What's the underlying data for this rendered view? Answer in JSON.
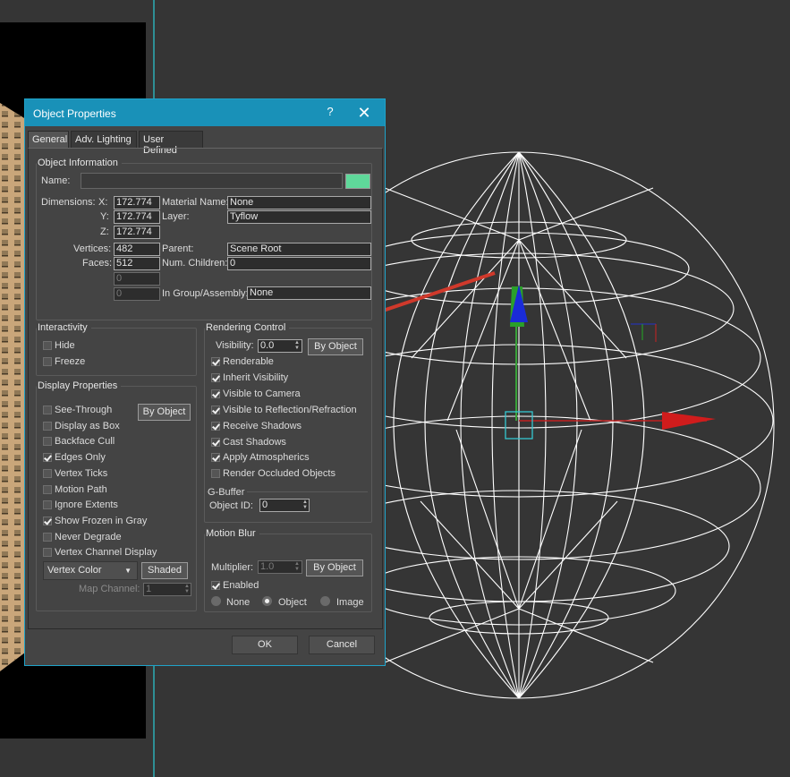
{
  "dialog": {
    "title": "Object Properties",
    "help": "?",
    "close": "✕",
    "tabs": [
      "General",
      "Adv. Lighting",
      "User Defined"
    ]
  },
  "object_info": {
    "title": "Object Information",
    "name_label": "Name:",
    "name_value": "",
    "color": "#5fd89a",
    "dimensions_label": "Dimensions:",
    "x_label": "X:",
    "x": "172.774",
    "y_label": "Y:",
    "y": "172.774",
    "z_label": "Z:",
    "z": "172.774",
    "material_label": "Material Name:",
    "material": "None",
    "layer_label": "Layer:",
    "layer": "Tyflow",
    "vertices_label": "Vertices:",
    "vertices": "482",
    "faces_label": "Faces:",
    "faces": "512",
    "parent_label": "Parent:",
    "parent": "Scene Root",
    "children_label": "Num. Children:",
    "children": "0",
    "extra1": "0",
    "extra2": "0",
    "group_label": "In Group/Assembly:",
    "group": "None"
  },
  "interactivity": {
    "title": "Interactivity",
    "hide": "Hide",
    "hide_checked": false,
    "freeze": "Freeze",
    "freeze_checked": false
  },
  "display": {
    "title": "Display Properties",
    "by_object": "By Object",
    "items": [
      {
        "label": "See-Through",
        "checked": false
      },
      {
        "label": "Display as Box",
        "checked": false
      },
      {
        "label": "Backface Cull",
        "checked": false
      },
      {
        "label": "Edges Only",
        "checked": true
      },
      {
        "label": "Vertex Ticks",
        "checked": false
      },
      {
        "label": "Motion Path",
        "checked": false
      },
      {
        "label": "Ignore Extents",
        "checked": false
      },
      {
        "label": "Show Frozen in Gray",
        "checked": true
      },
      {
        "label": "Never Degrade",
        "checked": false
      },
      {
        "label": "Vertex Channel Display",
        "checked": false
      }
    ],
    "vertex_color": "Vertex Color",
    "shaded": "Shaded",
    "map_channel_label": "Map Channel:",
    "map_channel": "1"
  },
  "rendering": {
    "title": "Rendering Control",
    "visibility_label": "Visibility:",
    "visibility": "0.0",
    "by_object": "By Object",
    "items": [
      {
        "label": "Renderable",
        "checked": true
      },
      {
        "label": "Inherit Visibility",
        "checked": true
      },
      {
        "label": "Visible to Camera",
        "checked": true
      },
      {
        "label": "Visible to Reflection/Refraction",
        "checked": true
      },
      {
        "label": "Receive Shadows",
        "checked": true
      },
      {
        "label": "Cast Shadows",
        "checked": true
      },
      {
        "label": "Apply Atmospherics",
        "checked": true
      },
      {
        "label": "Render Occluded Objects",
        "checked": false
      }
    ],
    "gbuffer_title": "G-Buffer",
    "object_id_label": "Object ID:",
    "object_id": "0"
  },
  "motion_blur": {
    "title": "Motion Blur",
    "multiplier_label": "Multiplier:",
    "multiplier": "1.0",
    "by_object": "By Object",
    "enabled": "Enabled",
    "enabled_checked": true,
    "none": "None",
    "object": "Object",
    "image": "Image",
    "selected": "Object"
  },
  "footer": {
    "ok": "OK",
    "cancel": "Cancel"
  },
  "colors": {
    "accent": "#1991b8",
    "wire": "#ffffff",
    "arrow": "#d0392b"
  }
}
